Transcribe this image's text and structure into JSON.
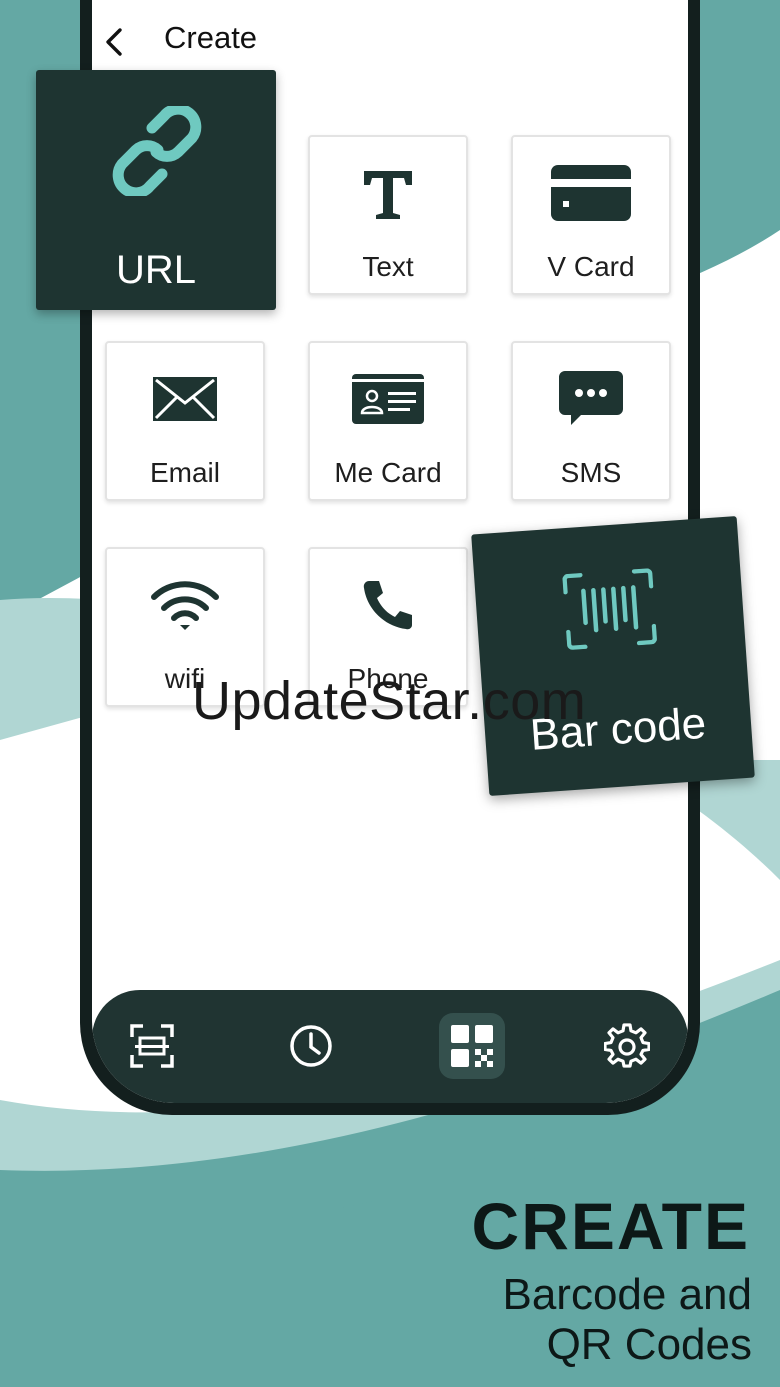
{
  "header": {
    "title": "Create"
  },
  "tiles": [
    {
      "label": "Text",
      "icon": "text-icon"
    },
    {
      "label": "V Card",
      "icon": "card-icon"
    },
    {
      "label": "Email",
      "icon": "email-icon"
    },
    {
      "label": "Me Card",
      "icon": "id-card-icon"
    },
    {
      "label": "SMS",
      "icon": "sms-icon"
    },
    {
      "label": "wifi",
      "icon": "wifi-icon"
    },
    {
      "label": "Phone",
      "icon": "phone-icon"
    }
  ],
  "featured": {
    "url": {
      "label": "URL",
      "icon": "link-icon"
    },
    "barcode": {
      "label": "Bar code",
      "icon": "barcode-scan-icon"
    }
  },
  "bottom_nav": [
    {
      "icon": "scan-icon",
      "active": false
    },
    {
      "icon": "history-icon",
      "active": false
    },
    {
      "icon": "qr-create-icon",
      "active": true
    },
    {
      "icon": "settings-icon",
      "active": false
    }
  ],
  "promo": {
    "title": "CREATE",
    "subtitle_line1": "Barcode and",
    "subtitle_line2": "QR Codes"
  },
  "watermark": "UpdateStar.com",
  "colors": {
    "dark": "#1e3431",
    "accent": "#6fc9c0",
    "teal": "#64a8a4",
    "teal_light": "#b0d6d3"
  }
}
